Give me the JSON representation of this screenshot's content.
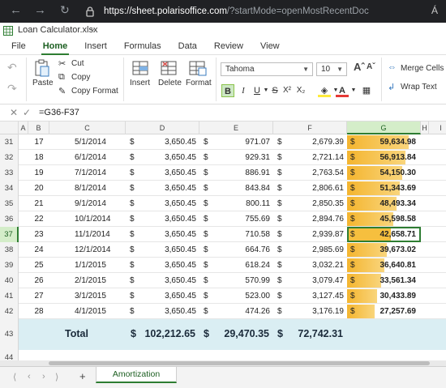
{
  "browser": {
    "url_host": "https://sheet.polarisoffice.com",
    "url_path": "/?startMode=openMostRecentDoc",
    "reader_icon": "Á"
  },
  "doc": {
    "filename": "Loan Calculator.xlsx"
  },
  "menu": [
    "File",
    "Home",
    "Insert",
    "Formulas",
    "Data",
    "Review",
    "View"
  ],
  "menu_active": "Home",
  "ribbon": {
    "paste": "Paste",
    "cut": "Cut",
    "copy": "Copy",
    "copy_format": "Copy Format",
    "insert": "Insert",
    "delete": "Delete",
    "format": "Format",
    "font": "Tahoma",
    "size": "10",
    "merge": "Merge Cells",
    "wrap": "Wrap Text"
  },
  "formula": "=G36-F37",
  "columns": [
    "A",
    "B",
    "C",
    "D",
    "E",
    "F",
    "G",
    "H",
    "I"
  ],
  "selected_column": "G",
  "rows": [
    {
      "n": "31",
      "b": "17",
      "c": "5/1/2014",
      "d": "3,650.45",
      "e": "971.07",
      "f": "2,679.39",
      "g": "59,634.98",
      "frac": 0.83
    },
    {
      "n": "32",
      "b": "18",
      "c": "6/1/2014",
      "d": "3,650.45",
      "e": "929.31",
      "f": "2,721.14",
      "g": "56,913.84",
      "frac": 0.79
    },
    {
      "n": "33",
      "b": "19",
      "c": "7/1/2014",
      "d": "3,650.45",
      "e": "886.91",
      "f": "2,763.54",
      "g": "54,150.30",
      "frac": 0.75
    },
    {
      "n": "34",
      "b": "20",
      "c": "8/1/2014",
      "d": "3,650.45",
      "e": "843.84",
      "f": "2,806.61",
      "g": "51,343.69",
      "frac": 0.71
    },
    {
      "n": "35",
      "b": "21",
      "c": "9/1/2014",
      "d": "3,650.45",
      "e": "800.11",
      "f": "2,850.35",
      "g": "48,493.34",
      "frac": 0.67
    },
    {
      "n": "36",
      "b": "22",
      "c": "10/1/2014",
      "d": "3,650.45",
      "e": "755.69",
      "f": "2,894.76",
      "g": "45,598.58",
      "frac": 0.63
    },
    {
      "n": "37",
      "b": "23",
      "c": "11/1/2014",
      "d": "3,650.45",
      "e": "710.58",
      "f": "2,939.87",
      "g": "42,658.71",
      "frac": 0.59
    },
    {
      "n": "38",
      "b": "24",
      "c": "12/1/2014",
      "d": "3,650.45",
      "e": "664.76",
      "f": "2,985.69",
      "g": "39,673.02",
      "frac": 0.54
    },
    {
      "n": "39",
      "b": "25",
      "c": "1/1/2015",
      "d": "3,650.45",
      "e": "618.24",
      "f": "3,032.21",
      "g": "36,640.81",
      "frac": 0.5
    },
    {
      "n": "40",
      "b": "26",
      "c": "2/1/2015",
      "d": "3,650.45",
      "e": "570.99",
      "f": "3,079.47",
      "g": "33,561.34",
      "frac": 0.46
    },
    {
      "n": "41",
      "b": "27",
      "c": "3/1/2015",
      "d": "3,650.45",
      "e": "523.00",
      "f": "3,127.45",
      "g": "30,433.89",
      "frac": 0.41
    },
    {
      "n": "42",
      "b": "28",
      "c": "4/1/2015",
      "d": "3,650.45",
      "e": "474.26",
      "f": "3,176.19",
      "g": "27,257.69",
      "frac": 0.37
    }
  ],
  "selected_row": "37",
  "currency": "$",
  "total": {
    "row": "43",
    "label": "Total",
    "d": "102,212.65",
    "e": "29,470.35",
    "f": "72,742.31"
  },
  "empty_row": "44",
  "sheet_tab": "Amortization"
}
